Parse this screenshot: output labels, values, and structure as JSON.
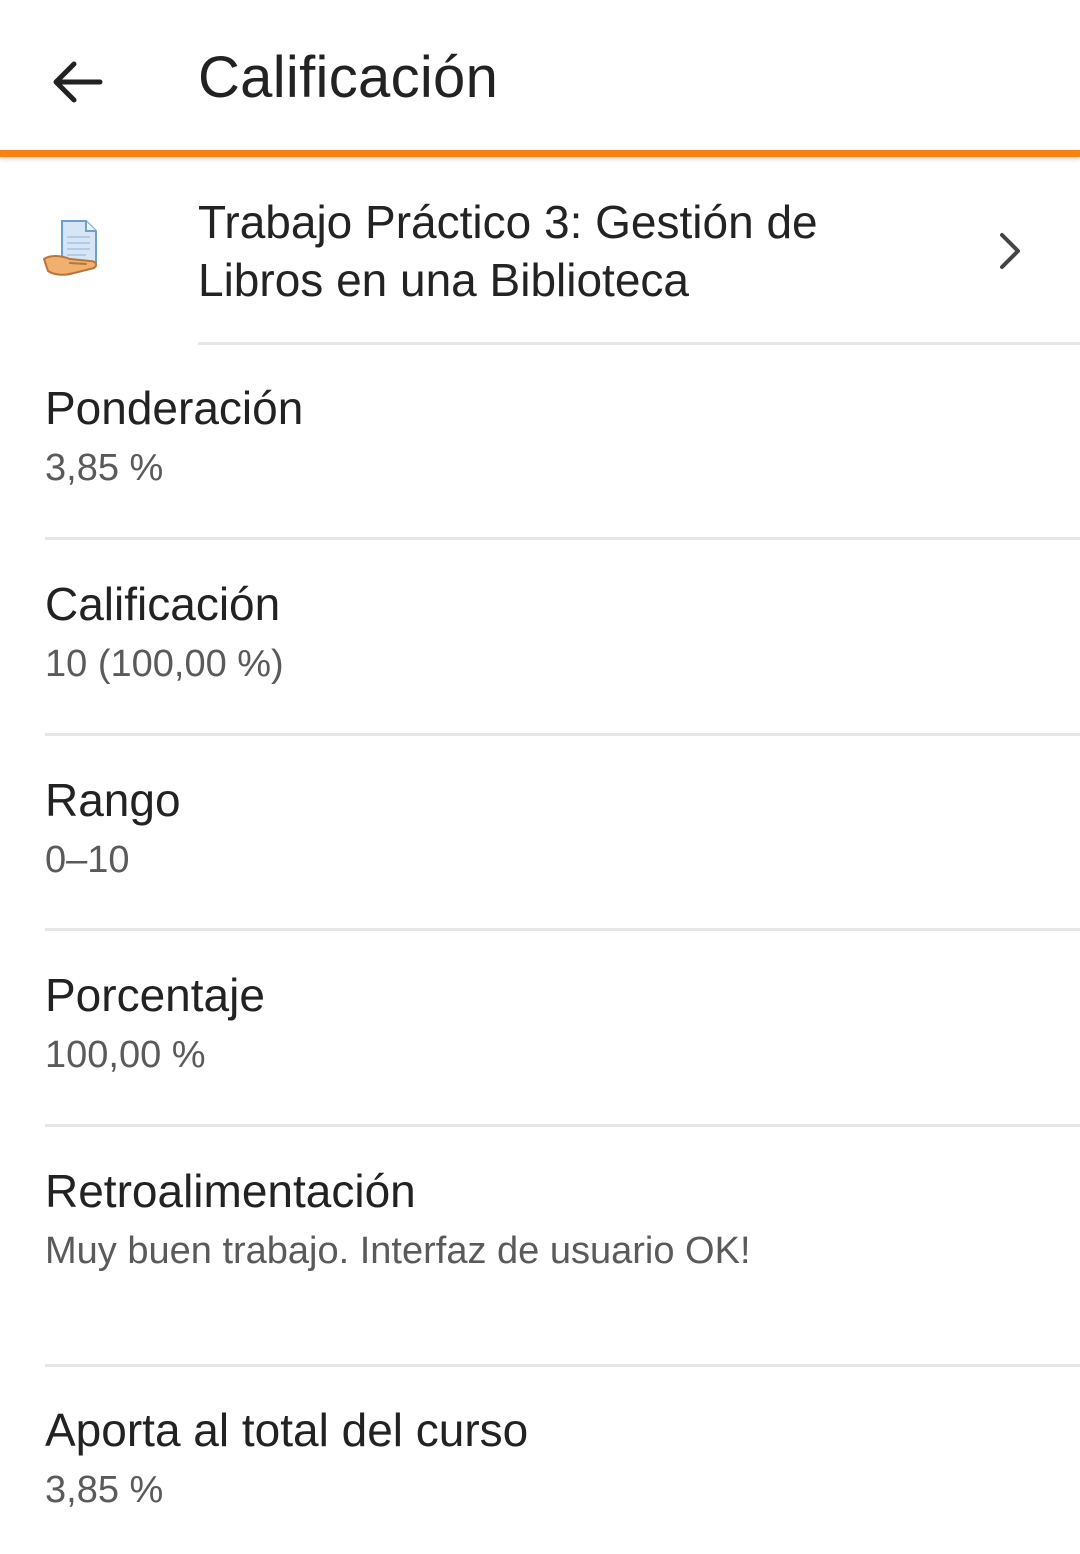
{
  "header": {
    "title": "Calificación",
    "back_icon": "arrow-left-icon"
  },
  "activity": {
    "icon": "assignment-icon",
    "title": "Trabajo Práctico 3: Gestión de Libros en una Biblioteca",
    "chevron_icon": "chevron-right-icon"
  },
  "details": {
    "ponderacion": {
      "label": "Ponderación",
      "value": "3,85 %"
    },
    "calificacion": {
      "label": "Calificación",
      "value": "10 (100,00 %)"
    },
    "rango": {
      "label": "Rango",
      "value": "0–10"
    },
    "porcentaje": {
      "label": "Porcentaje",
      "value": "100,00 %"
    },
    "retroalimentacion": {
      "label": "Retroalimentación",
      "value": "Muy buen trabajo. Interfaz de usuario OK!"
    },
    "aporte": {
      "label": "Aporta al total del curso",
      "value": "3,85 %"
    }
  },
  "colors": {
    "accent": "#f98012",
    "divider": "#e6e6e6",
    "text_primary": "#222222",
    "text_secondary": "#5a5a5a"
  }
}
